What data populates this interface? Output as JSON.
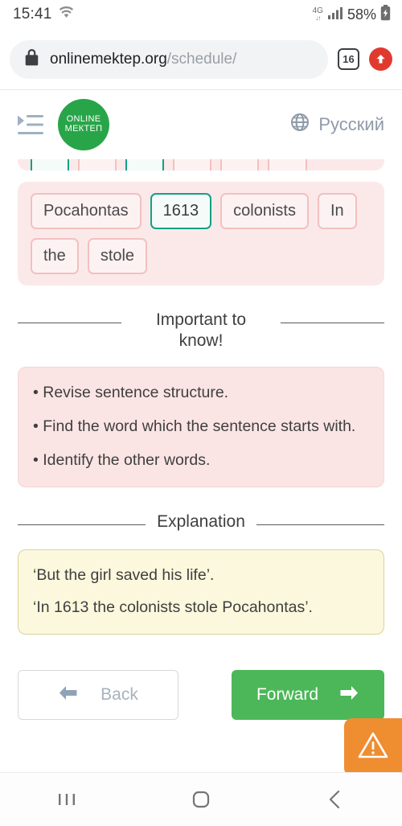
{
  "status_bar": {
    "time": "15:41",
    "wifi_icon": "wifi-icon",
    "network_type": "4G",
    "network_arrows": "↓↑",
    "signal_icon": "signal-bars-icon",
    "battery_percent": "58%",
    "battery_icon": "battery-charging-icon"
  },
  "browser": {
    "lock_icon": "lock-icon",
    "url_host": "onlinemektep.org",
    "url_path": "/schedule/",
    "tab_count": "16",
    "upload_icon": "upload-arrow-icon"
  },
  "header": {
    "menu_icon": "sidebar-expand-icon",
    "logo_line1": "ONLINE",
    "logo_line2": "МЕКТЕП",
    "globe_icon": "globe-icon",
    "language": "Русский",
    "logo_color": "#28a548"
  },
  "word_bank": {
    "clipped_row": [
      {
        "label": "",
        "state": "selected"
      },
      {
        "label": "",
        "state": "default"
      },
      {
        "label": "",
        "state": "selected"
      },
      {
        "label": "",
        "state": "default"
      },
      {
        "label": "",
        "state": "default"
      },
      {
        "label": "",
        "state": "default"
      }
    ],
    "tiles": [
      {
        "label": "Pocahontas",
        "state": "default"
      },
      {
        "label": "1613",
        "state": "selected"
      },
      {
        "label": "colonists",
        "state": "default"
      },
      {
        "label": "In",
        "state": "default"
      },
      {
        "label": "the",
        "state": "default"
      },
      {
        "label": "stole",
        "state": "default"
      }
    ],
    "tile_border_color": "#f3c0c0",
    "selected_border_color": "#13a085"
  },
  "important": {
    "divider_label": "Important to know!",
    "bullets": [
      "• Revise sentence structure.",
      "• Find the word which the sentence starts with.",
      "• Identify the other words."
    ]
  },
  "explanation": {
    "divider_label": "Explanation",
    "lines": [
      "‘But the girl saved his life’.",
      "‘In 1613 the colonists stole Pocahontas’."
    ]
  },
  "nav": {
    "back_label": "Back",
    "back_icon": "arrow-left-icon",
    "forward_label": "Forward",
    "forward_icon": "arrow-right-icon",
    "forward_color": "#4cb758"
  },
  "warning_fab": {
    "icon": "warning-triangle-icon",
    "color": "#ef8e31"
  },
  "android_nav": {
    "recents_icon": "recents-icon",
    "home_icon": "home-icon",
    "back_icon": "back-chevron-icon"
  }
}
